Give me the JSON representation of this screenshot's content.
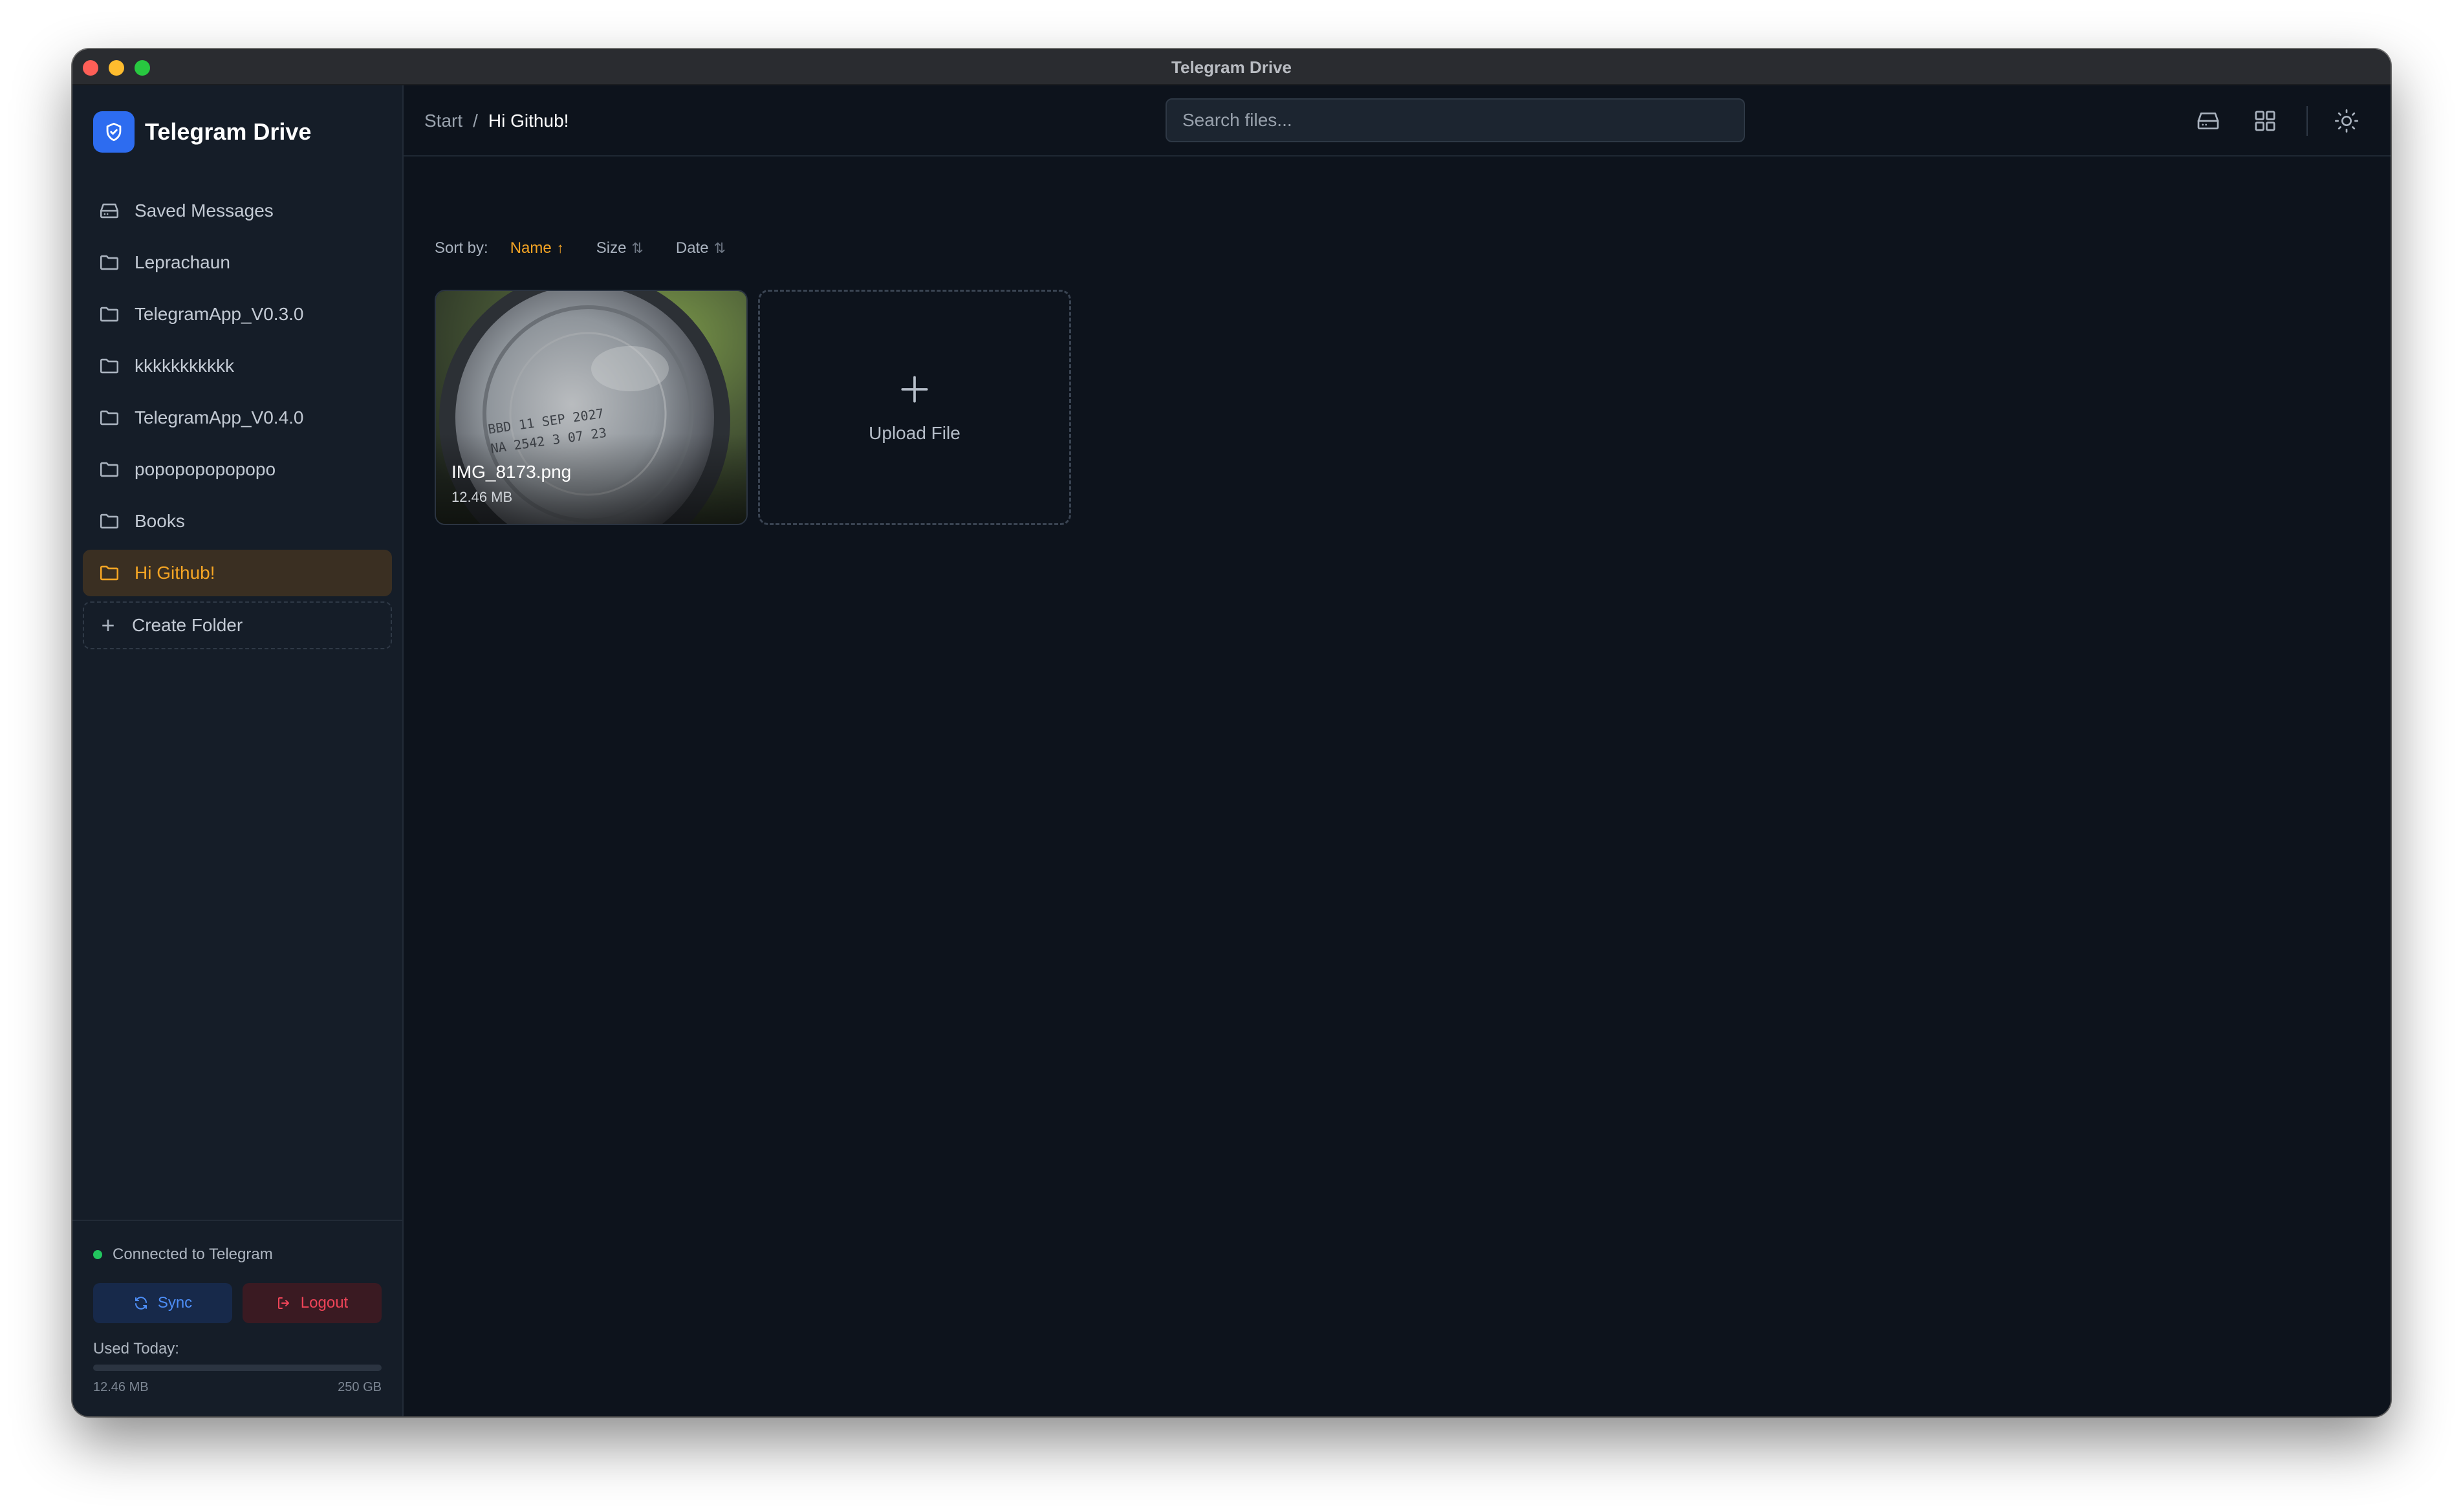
{
  "window": {
    "title": "Telegram Drive"
  },
  "sidebar": {
    "brand": "Telegram Drive",
    "items": [
      {
        "label": "Saved Messages",
        "icon": "drive-icon",
        "active": false
      },
      {
        "label": "Leprachaun",
        "icon": "folder-icon",
        "active": false
      },
      {
        "label": "TelegramApp_V0.3.0",
        "icon": "folder-icon",
        "active": false
      },
      {
        "label": "kkkkkkkkkkk",
        "icon": "folder-icon",
        "active": false
      },
      {
        "label": "TelegramApp_V0.4.0",
        "icon": "folder-icon",
        "active": false
      },
      {
        "label": "popopopopopopo",
        "icon": "folder-icon",
        "active": false
      },
      {
        "label": "Books",
        "icon": "folder-icon",
        "active": false
      },
      {
        "label": "Hi Github!",
        "icon": "folder-icon",
        "active": true
      }
    ],
    "create_folder": "Create Folder",
    "footer": {
      "status": "Connected to Telegram",
      "sync": "Sync",
      "logout": "Logout",
      "used_label": "Used Today:",
      "used": "12.46 MB",
      "limit": "250 GB",
      "used_fraction": 5e-05
    }
  },
  "header": {
    "breadcrumb": {
      "root": "Start",
      "separator": "/",
      "current": "Hi Github!"
    },
    "search_placeholder": "Search files..."
  },
  "sort": {
    "label": "Sort by:",
    "options": [
      {
        "label": "Name",
        "arrow": "↑",
        "active": true
      },
      {
        "label": "Size",
        "arrow": "⇅",
        "active": false
      },
      {
        "label": "Date",
        "arrow": "⇅",
        "active": false
      }
    ]
  },
  "files": [
    {
      "name": "IMG_8173.png",
      "size": "12.46 MB"
    }
  ],
  "upload": {
    "label": "Upload File",
    "icon": "plus-icon"
  },
  "colors": {
    "accent": "#f5a524",
    "brand": "#2d6cf0",
    "connected": "#22c55e",
    "logout": "#ef4458",
    "sync": "#4d8ef7"
  }
}
